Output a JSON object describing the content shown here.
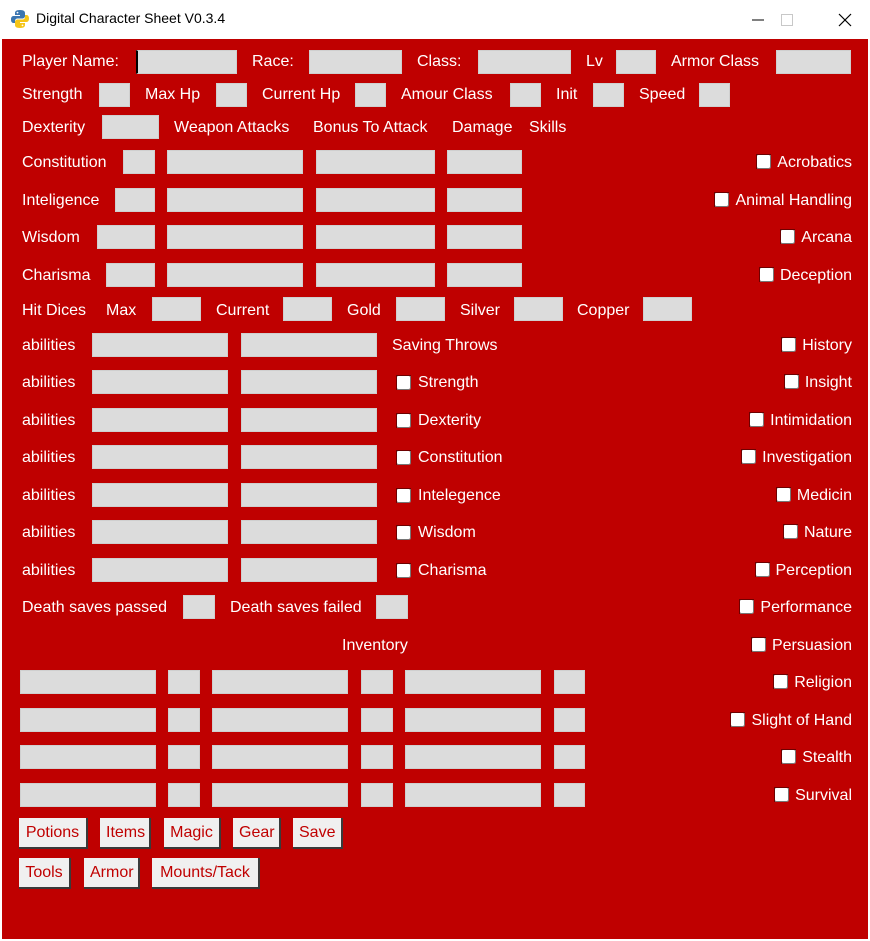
{
  "window": {
    "title": "Digital Character Sheet V0.3.4",
    "icon": "python-icon",
    "controls": [
      "minimize-icon",
      "maximize-icon",
      "close-icon"
    ]
  },
  "header": {
    "player_name": "Player Name:",
    "race": "Race:",
    "class": "Class:",
    "level": "Lv",
    "armor_class": "Armor Class"
  },
  "stats_row": {
    "strength": "Strength",
    "max_hp": "Max Hp",
    "current_hp": "Current Hp",
    "amour_class": "Amour Class",
    "init": "Init",
    "speed": "Speed"
  },
  "dex_row": {
    "dexterity": "Dexterity",
    "weapon_attacks": "Weapon Attacks",
    "bonus_to_attack": "Bonus To Attack",
    "damage": "Damage",
    "skills": "Skills"
  },
  "attributes": [
    "Constitution",
    "Inteligence",
    "Wisdom",
    "Charisma"
  ],
  "hit_dice_row": {
    "hit_dices": "Hit Dices",
    "max": "Max",
    "current": "Current",
    "gold": "Gold",
    "silver": "Silver",
    "copper": "Copper"
  },
  "abilities_label": "abilities",
  "saving_throws": {
    "title": "Saving Throws",
    "items": [
      "Strength",
      "Dexterity",
      "Constitution",
      "Intelegence",
      "Wisdom",
      "Charisma"
    ]
  },
  "death_saves": {
    "passed": "Death saves passed",
    "failed": "Death saves failed"
  },
  "inventory": {
    "title": "Inventory"
  },
  "skills": [
    "Acrobatics",
    "Animal Handling",
    "Arcana",
    "Deception",
    "History",
    "Insight",
    "Intimidation",
    "Investigation",
    "Medicin",
    "Nature",
    "Perception",
    "Performance",
    "Persuasion",
    "Religion",
    "Slight of Hand",
    "Stealth",
    "Survival"
  ],
  "buttons": {
    "row1": [
      "Potions",
      "Items",
      "Magic",
      "Gear",
      "Save"
    ],
    "row2": [
      "Tools",
      "Armor",
      "Mounts/Tack"
    ]
  },
  "colors": {
    "background": "#bf0000",
    "text": "#ffffff",
    "field": "#dcdcdc",
    "button_text": "#c00000"
  }
}
